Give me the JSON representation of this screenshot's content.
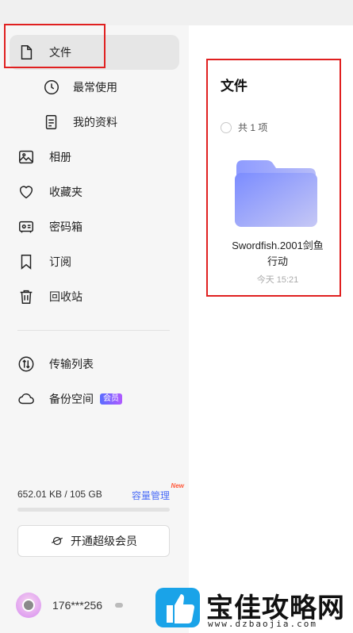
{
  "sidebar": {
    "items": [
      {
        "label": "文件",
        "icon": "file-icon",
        "active": true
      },
      {
        "label": "最常使用",
        "icon": "clock-icon",
        "sub": true
      },
      {
        "label": "我的资料",
        "icon": "document-icon",
        "sub": true
      },
      {
        "label": "相册",
        "icon": "photo-icon"
      },
      {
        "label": "收藏夹",
        "icon": "heart-icon"
      },
      {
        "label": "密码箱",
        "icon": "safe-icon"
      },
      {
        "label": "订阅",
        "icon": "bookmark-icon"
      },
      {
        "label": "回收站",
        "icon": "trash-icon"
      },
      {
        "label": "传输列表",
        "icon": "transfer-icon"
      },
      {
        "label": "备份空间",
        "icon": "cloud-icon",
        "badge": "会员"
      }
    ],
    "storage": {
      "usage_text": "652.01 KB / 105 GB",
      "manage_label": "容量管理",
      "new_tag": "New",
      "used_fraction": 0.0
    },
    "upgrade_label": "开通超级会员",
    "user": {
      "name": "176***256"
    }
  },
  "main": {
    "title": "文件",
    "count_text": "共 1 项",
    "files": [
      {
        "name": "Swordfish.2001剑鱼行动",
        "date": "今天 15:21",
        "type": "folder"
      }
    ]
  },
  "watermark": {
    "text": "宝佳攻略网",
    "url": "www.dzbaojia.com"
  },
  "colors": {
    "accent": "#4a6cf7",
    "highlight_box": "#e02020",
    "sidebar_bg": "#f6f6f6",
    "active_bg": "#e6e6e6",
    "folder_gradient": [
      "#7b8cff",
      "#c6c8f5"
    ]
  }
}
